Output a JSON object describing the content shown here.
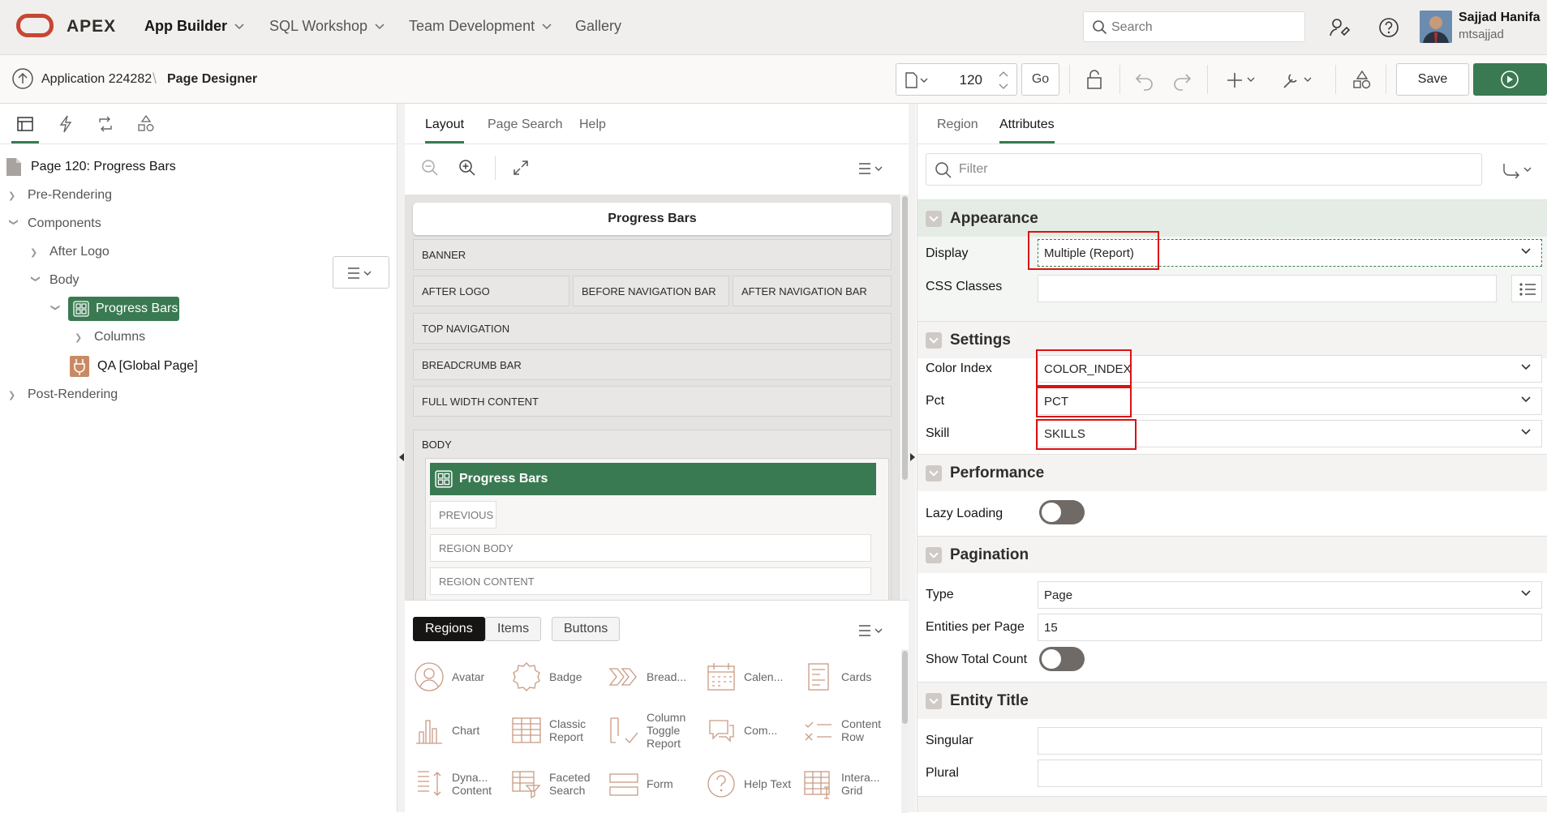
{
  "topbar": {
    "brand": "APEX",
    "nav": [
      {
        "label": "App Builder"
      },
      {
        "label": "SQL Workshop"
      },
      {
        "label": "Team Development"
      },
      {
        "label": "Gallery"
      }
    ],
    "search_placeholder": "Search",
    "user_name": "Sajjad Hanifa",
    "user_id": "mtsajjad"
  },
  "subbar": {
    "app_crumb": "Application 224282",
    "page_crumb": "Page Designer",
    "page_number": "120",
    "go_label": "Go",
    "save_label": "Save"
  },
  "left": {
    "root": "Page 120: Progress Bars",
    "tree": {
      "pre_rendering": "Pre-Rendering",
      "components": "Components",
      "after_logo": "After Logo",
      "body": "Body",
      "progress_bars": "Progress Bars",
      "columns": "Columns",
      "qa": "QA [Global Page]",
      "post_rendering": "Post-Rendering"
    }
  },
  "center": {
    "tabs": [
      "Layout",
      "Page Search",
      "Help"
    ],
    "page_title": "Progress Bars",
    "slots": {
      "banner": "BANNER",
      "after_logo": "AFTER LOGO",
      "before_nav": "BEFORE NAVIGATION BAR",
      "after_nav": "AFTER NAVIGATION BAR",
      "top_nav": "TOP NAVIGATION",
      "breadcrumb": "BREADCRUMB BAR",
      "full_width": "FULL WIDTH CONTENT",
      "body": "BODY"
    },
    "region_title": "Progress Bars",
    "region_slots": {
      "previous": "PREVIOUS",
      "region_body": "REGION BODY",
      "region_content": "REGION CONTENT"
    },
    "gallery_tabs": [
      "Regions",
      "Items",
      "Buttons"
    ],
    "gallery_items": [
      "Avatar",
      "Badge",
      "Bread...",
      "Calen...",
      "Cards",
      "Chart",
      "Classic Report",
      "Column Toggle Report",
      "Com...",
      "Content Row",
      "Dyna... Content",
      "Faceted Search",
      "Form",
      "Help Text",
      "Intera... Grid"
    ]
  },
  "right": {
    "tabs": [
      "Region",
      "Attributes"
    ],
    "filter_placeholder": "Filter",
    "appearance": {
      "title": "Appearance",
      "display_label": "Display",
      "display_value": "Multiple (Report)",
      "css_label": "CSS Classes",
      "css_value": ""
    },
    "settings": {
      "title": "Settings",
      "color_label": "Color Index",
      "color_value": "COLOR_INDEX",
      "pct_label": "Pct",
      "pct_value": "PCT",
      "skill_label": "Skill",
      "skill_value": "SKILLS"
    },
    "performance": {
      "title": "Performance",
      "lazy_label": "Lazy Loading"
    },
    "pagination": {
      "title": "Pagination",
      "type_label": "Type",
      "type_value": "Page",
      "entities_label": "Entities per Page",
      "entities_value": "15",
      "total_label": "Show Total Count"
    },
    "entity": {
      "title": "Entity Title",
      "singular_label": "Singular",
      "plural_label": "Plural"
    }
  }
}
